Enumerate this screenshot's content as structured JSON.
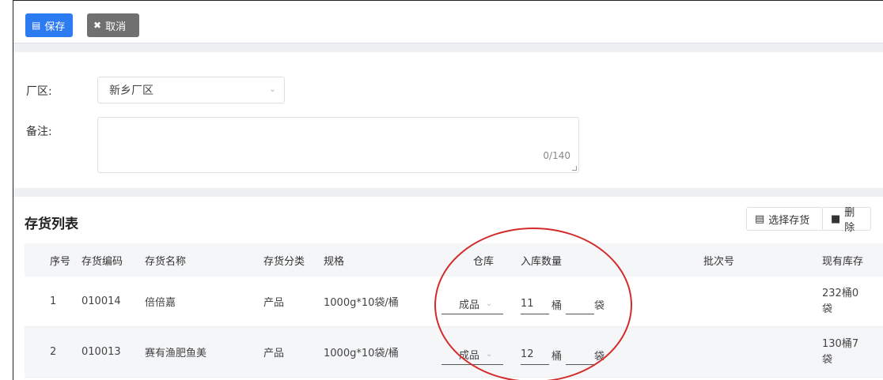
{
  "toolbar": {
    "save_label": "保存",
    "cancel_label": "取消"
  },
  "form": {
    "factory_label": "厂区:",
    "factory_value": "新乡厂区",
    "remark_label": "备注:",
    "remark_value": "",
    "remark_count": "0/140"
  },
  "inventory": {
    "title": "存货列表",
    "select_button": "选择存货",
    "delete_button": "删除",
    "columns": {
      "seq": "序号",
      "code": "存货编码",
      "name": "存货名称",
      "category": "存货分类",
      "spec": "规格",
      "warehouse": "仓库",
      "qty": "入库数量",
      "batch": "批次号",
      "stock": "现有库存"
    },
    "rows": [
      {
        "seq": "1",
        "code": "010014",
        "name": "倍倍嘉",
        "category": "产品",
        "spec": "1000g*10袋/桶",
        "warehouse": "成品",
        "qty_barrel": "11",
        "unit_barrel": "桶",
        "qty_bag": "",
        "unit_bag": "袋",
        "stock_line1": "232桶0",
        "stock_line2": "袋"
      },
      {
        "seq": "2",
        "code": "010013",
        "name": "赛有渔肥鱼美",
        "category": "产品",
        "spec": "1000g*10袋/桶",
        "warehouse": "成品",
        "qty_barrel": "12",
        "unit_barrel": "桶",
        "qty_bag": "",
        "unit_bag": "袋",
        "stock_line1": "130桶7",
        "stock_line2": "袋"
      }
    ]
  },
  "colors": {
    "primary": "#2d7bf0",
    "cancel_gray": "#707070",
    "annotation_red": "#d32a2a"
  },
  "icons": {
    "save": "save-icon",
    "cancel": "close-circle-icon",
    "select": "box-icon",
    "delete": "trash-icon",
    "dropdown": "chevron-down-icon"
  }
}
